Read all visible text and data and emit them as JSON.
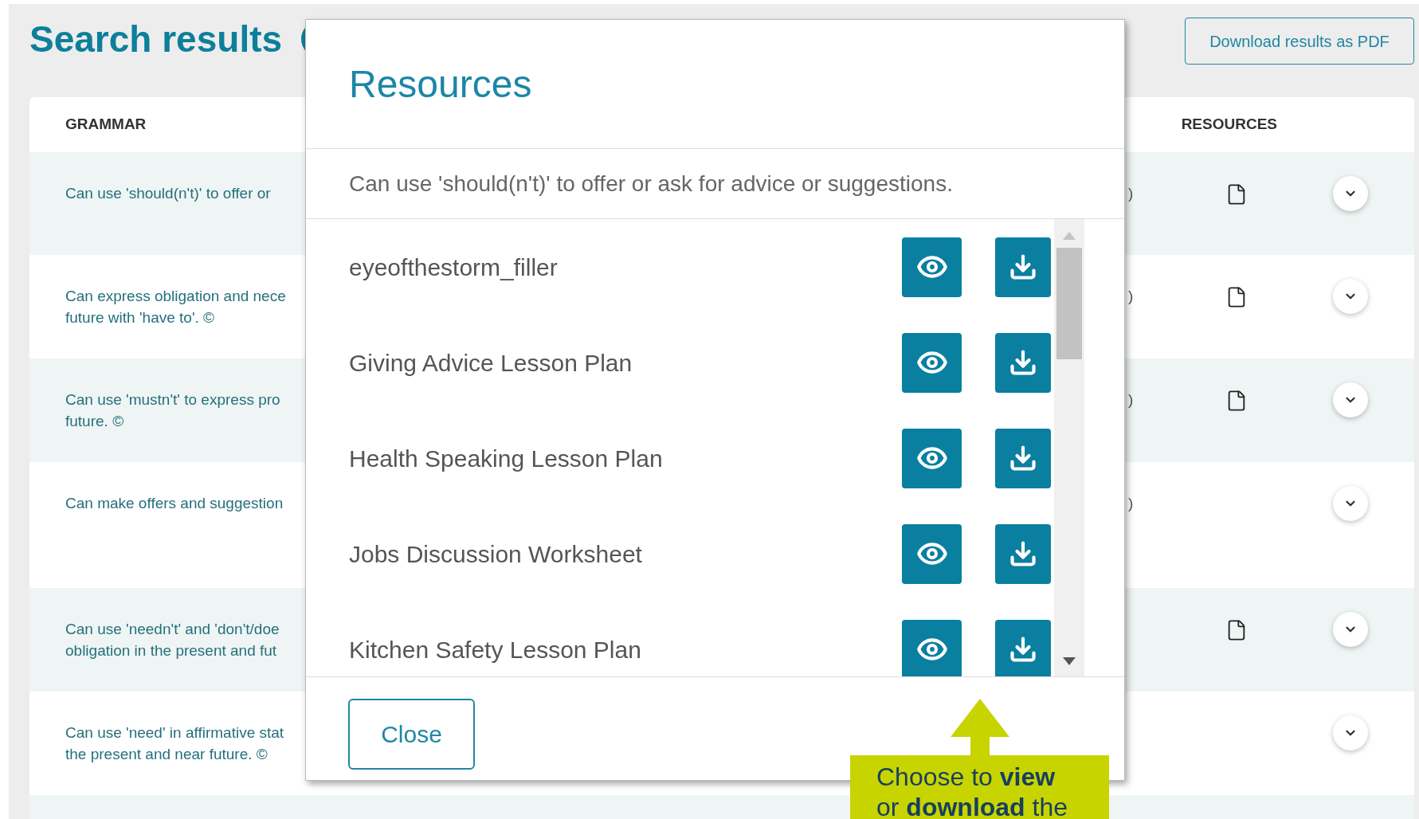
{
  "page": {
    "title": "Search results",
    "download_button": "Download results as PDF"
  },
  "table": {
    "columns": [
      "GRAMMAR",
      "RESOURCES"
    ],
    "rows": [
      {
        "lines": [
          "Can use 'should(n't)' to offer or"
        ],
        "column_3": ")",
        "has_resource": true
      },
      {
        "lines": [
          "Can express obligation and nece",
          "future with 'have to'. ©"
        ],
        "column_3": ")",
        "has_resource": true
      },
      {
        "lines": [
          "Can use 'mustn't' to express pro",
          "future. ©"
        ],
        "column_3": ")",
        "has_resource": true
      },
      {
        "lines": [
          "Can make offers and suggestion"
        ],
        "column_3": ")",
        "has_resource": false
      },
      {
        "lines": [
          "Can use 'needn't' and 'don't/doe",
          "obligation in the present and fut"
        ],
        "has_resource": true
      },
      {
        "lines": [
          "Can use 'need' in affirmative stat",
          "the present and near future. ©"
        ],
        "has_resource": false
      }
    ]
  },
  "modal": {
    "title": "Resources",
    "subtitle": "Can use 'should(n't)' to offer or ask for advice or suggestions.",
    "items": [
      {
        "name": "eyeofthestorm_filler"
      },
      {
        "name": "Giving Advice Lesson Plan"
      },
      {
        "name": "Health Speaking Lesson Plan"
      },
      {
        "name": "Jobs Discussion Worksheet"
      },
      {
        "name": "Kitchen Safety Lesson Plan"
      }
    ],
    "close_button": "Close"
  },
  "callout": {
    "lines": [
      "Choose to **view**",
      "or **download** the"
    ]
  }
}
